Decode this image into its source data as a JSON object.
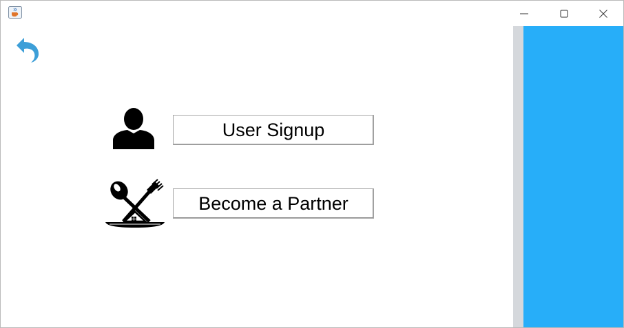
{
  "window": {
    "icon": "java-cup-icon",
    "controls": [
      "minimize-icon",
      "maximize-icon",
      "close-icon"
    ]
  },
  "main": {
    "back_icon": "back-arrow-icon",
    "options": [
      {
        "icon": "user-icon",
        "label": "User Signup"
      },
      {
        "icon": "restaurant-icon",
        "label": "Become a Partner"
      }
    ]
  },
  "colors": {
    "accent": "#27aef9",
    "back_arrow": "#3d9fd8",
    "divider": "#d5d8dc"
  }
}
